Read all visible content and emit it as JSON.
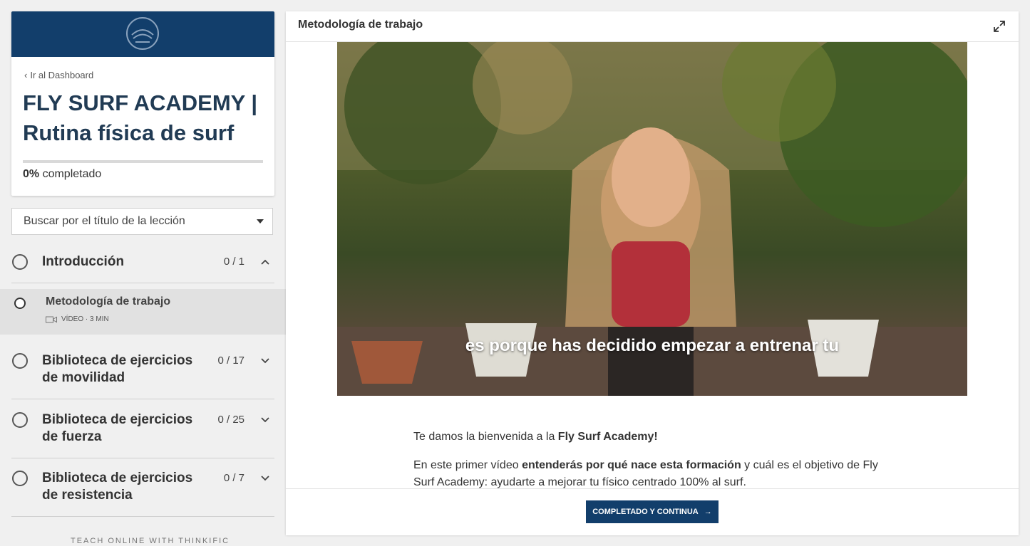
{
  "sidebar": {
    "back_link": "Ir al Dashboard",
    "course_title": "FLY SURF ACADEMY | Rutina física de surf",
    "progress": {
      "percent_label": "0%",
      "suffix": "completado",
      "value": 0
    },
    "search": {
      "placeholder": "Buscar por el título de la lección"
    },
    "chapters": [
      {
        "title": "Introducción",
        "count": "0 / 1",
        "expanded": true
      },
      {
        "title": "Biblioteca de ejercicios de movilidad",
        "count": "0 / 17",
        "expanded": false
      },
      {
        "title": "Biblioteca de ejercicios de fuerza",
        "count": "0 / 25",
        "expanded": false
      },
      {
        "title": "Biblioteca de ejercicios de resistencia",
        "count": "0 / 7",
        "expanded": false
      }
    ],
    "active_lesson": {
      "title": "Metodología de trabajo",
      "meta": "VÍDEO · 3 MIN"
    },
    "footer": "TEACH ONLINE WITH THINKIFIC"
  },
  "main": {
    "title": "Metodología de trabajo",
    "video": {
      "caption": "es porque has decidido empezar a entrenar tu"
    },
    "paragraphs": [
      {
        "pre": "Te damos la bienvenida a la ",
        "bold": "Fly Surf Academy!",
        "post": ""
      },
      {
        "pre": "En este primer vídeo ",
        "bold": "entenderás por qué nace esta formación",
        "post": " y cuál es el objetivo de Fly Surf Academy: ayudarte a mejorar tu físico centrado 100% al surf."
      }
    ],
    "complete_button": "COMPLETADO Y CONTINUA"
  },
  "colors": {
    "brand": "#123e6b",
    "active_row": "#e1e1e1"
  }
}
